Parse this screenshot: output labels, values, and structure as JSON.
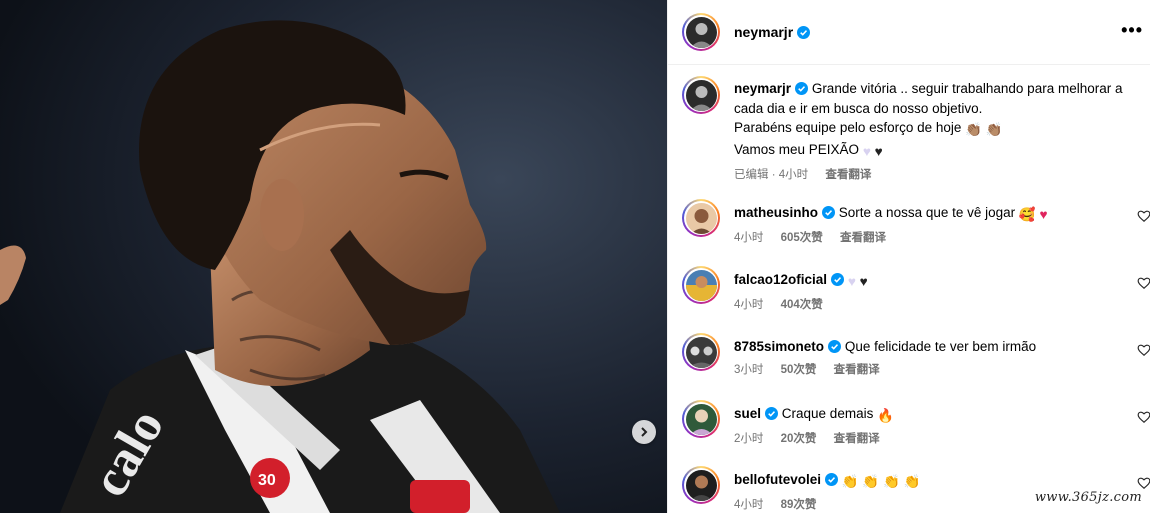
{
  "post": {
    "author": "neymarjr",
    "more_label": "•••",
    "caption": {
      "username": "neymarjr",
      "line1": "Grande vitória .. seguir trabalhando para melhorar a",
      "line2": "cada dia e ir em busca do nosso objetivo.",
      "line3": "Parabéns equipe pelo esforço de hoje",
      "line4": "Vamos meu PEIXÃO",
      "edited": "已编辑 · 4小时",
      "translate": "查看翻译"
    }
  },
  "comments": [
    {
      "username": "matheusinho",
      "text": "Sorte a nossa que te vê jogar",
      "time": "4小时",
      "likes": "605次赞",
      "translate": "查看翻译"
    },
    {
      "username": "falcao12oficial",
      "text": "",
      "time": "4小时",
      "likes": "404次赞",
      "translate": ""
    },
    {
      "username": "8785simoneto",
      "text": "Que felicidade te ver bem irmão",
      "time": "3小时",
      "likes": "50次赞",
      "translate": "查看翻译"
    },
    {
      "username": "suel",
      "text": "Craque demais",
      "time": "2小时",
      "likes": "20次赞",
      "translate": "查看翻译"
    },
    {
      "username": "bellofutevolei",
      "text": "",
      "time": "4小时",
      "likes": "89次赞",
      "translate": ""
    }
  ],
  "watermark": "www.365jz.com",
  "colors": {
    "verified": "#0095f6",
    "meta": "#737373",
    "photo_bg": "#141a24"
  },
  "icons": {
    "more": "more-options-icon",
    "next": "chevron-right-icon",
    "verified": "verified-badge-icon",
    "like": "heart-outline-icon"
  }
}
